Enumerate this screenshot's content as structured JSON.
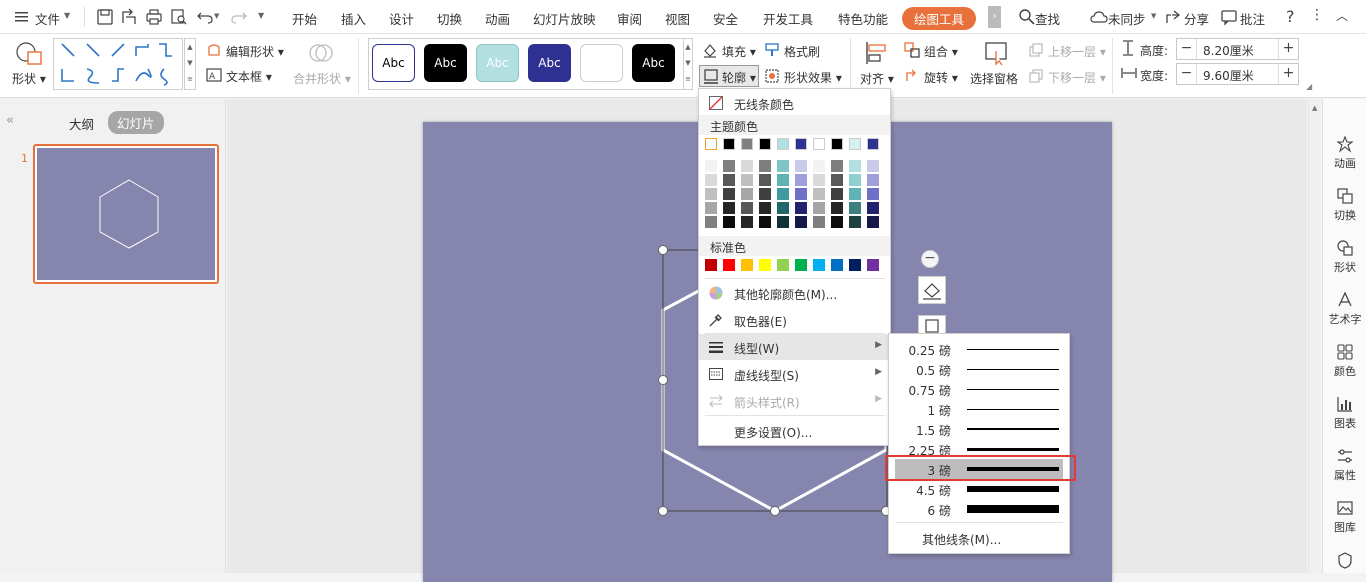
{
  "menubar": {
    "file_menu": "文件",
    "tabs": [
      "开始",
      "插入",
      "设计",
      "切换",
      "动画",
      "幻灯片放映",
      "审阅",
      "视图",
      "安全",
      "开发工具",
      "特色功能"
    ],
    "active_tab": "绘图工具",
    "search": "查找",
    "sync": "未同步",
    "share": "分享",
    "comment": "批注",
    "accent_color": "#e8703a"
  },
  "ribbon": {
    "shape_label": "形状",
    "edit_shape": "编辑形状",
    "text_box": "文本框",
    "merge_shape": "合并形状",
    "style_samples": [
      "Abc",
      "Abc",
      "Abc",
      "Abc",
      "",
      "Abc"
    ],
    "fill": "填充",
    "format_painter": "格式刷",
    "outline": "轮廓",
    "shape_effect": "形状效果",
    "align": "对齐",
    "group": "组合",
    "rotate": "旋转",
    "selection_pane": "选择窗格",
    "bring_forward": "上移一层",
    "send_backward": "下移一层",
    "height_label": "高度:",
    "height_value": "8.20厘米",
    "width_label": "宽度:",
    "width_value": "9.60厘米"
  },
  "leftpanel": {
    "tab_outline": "大纲",
    "tab_slides": "幻灯片",
    "slide_number": "1",
    "thumb_color": "#8585ad"
  },
  "rightbar": {
    "items": [
      "动画",
      "切换",
      "形状",
      "艺术字",
      "颜色",
      "图表",
      "属性",
      "图库"
    ]
  },
  "outline_menu": {
    "no_line_color": "无线条颜色",
    "theme_colors_title": "主题颜色",
    "theme_top_row": [
      "#ffffff",
      "#000000",
      "#7f7f7f",
      "#000000",
      "#b2dfe0",
      "#2e3192",
      "#ffffff",
      "#000000",
      "#d9f0f0",
      "#2e3192"
    ],
    "standard_colors_title": "标准色",
    "standard_colors": [
      "#c00000",
      "#ff0000",
      "#ffc000",
      "#ffff00",
      "#92d050",
      "#00b050",
      "#00b0f0",
      "#0070c0",
      "#002060",
      "#7030a0"
    ],
    "more_colors": "其他轮廓颜色(M)...",
    "eyedropper": "取色器(E)",
    "line_style": "线型(W)",
    "dash_style": "虚线线型(S)",
    "arrow_style": "箭头样式(R)",
    "more_settings": "更多设置(O)..."
  },
  "line_weight_menu": {
    "items": [
      "0.25 磅",
      "0.5 磅",
      "0.75 磅",
      "1 磅",
      "1.5 磅",
      "2.25 磅",
      "3 磅",
      "4.5 磅",
      "6 磅"
    ],
    "weights": [
      0.25,
      0.5,
      0.75,
      1,
      1.5,
      2.25,
      3,
      4.5,
      6
    ],
    "selected": "3 磅",
    "other_lines": "其他线条(M)..."
  }
}
